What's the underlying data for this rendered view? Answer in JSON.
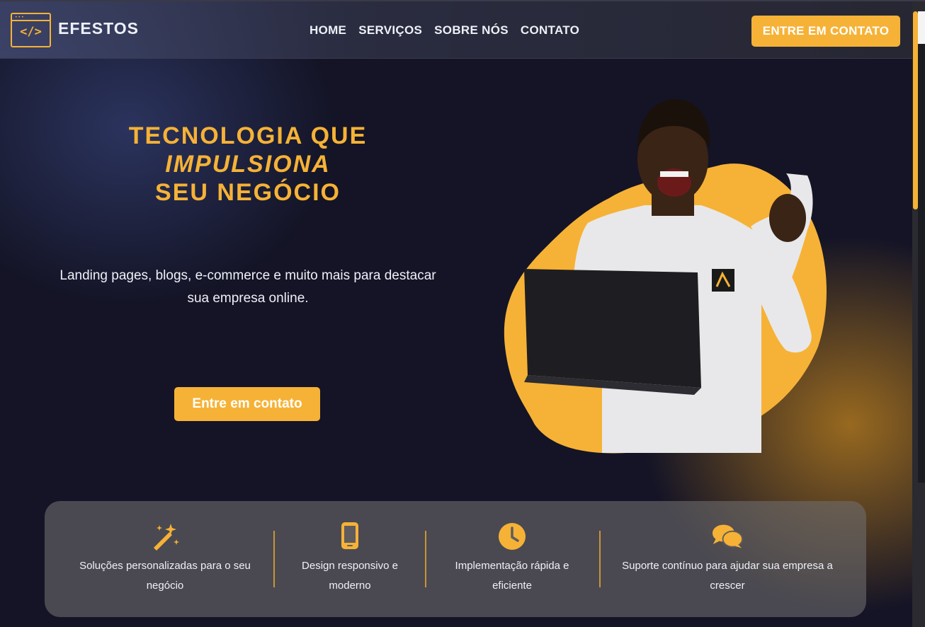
{
  "brand": {
    "name": "EFESTOS",
    "logo_symbol": "</>"
  },
  "nav": {
    "items": [
      {
        "label": "HOME"
      },
      {
        "label": "SERVIÇOS"
      },
      {
        "label": "SOBRE NÓS"
      },
      {
        "label": "CONTATO"
      }
    ],
    "cta_label": "ENTRE EM CONTATO"
  },
  "hero": {
    "title_part1": "TECNOLOGIA QUE ",
    "title_highlight": "IMPULSIONA",
    "title_part2": "SEU NEGÓCIO",
    "subtitle": "Landing pages, blogs, e-commerce e muito mais para destacar sua empresa online.",
    "button_label": "Entre em contato"
  },
  "features": [
    {
      "icon": "magic-wand-icon",
      "text": "Soluções personalizadas para o seu negócio"
    },
    {
      "icon": "mobile-phone-icon",
      "text": "Design responsivo e moderno"
    },
    {
      "icon": "clock-icon",
      "text": "Implementação rápida e eficiente"
    },
    {
      "icon": "chat-bubbles-icon",
      "text": "Suporte contínuo para ajudar sua empresa a crescer"
    }
  ],
  "colors": {
    "accent": "#f6b236",
    "background": "#141426",
    "text": "#eef0f8"
  }
}
